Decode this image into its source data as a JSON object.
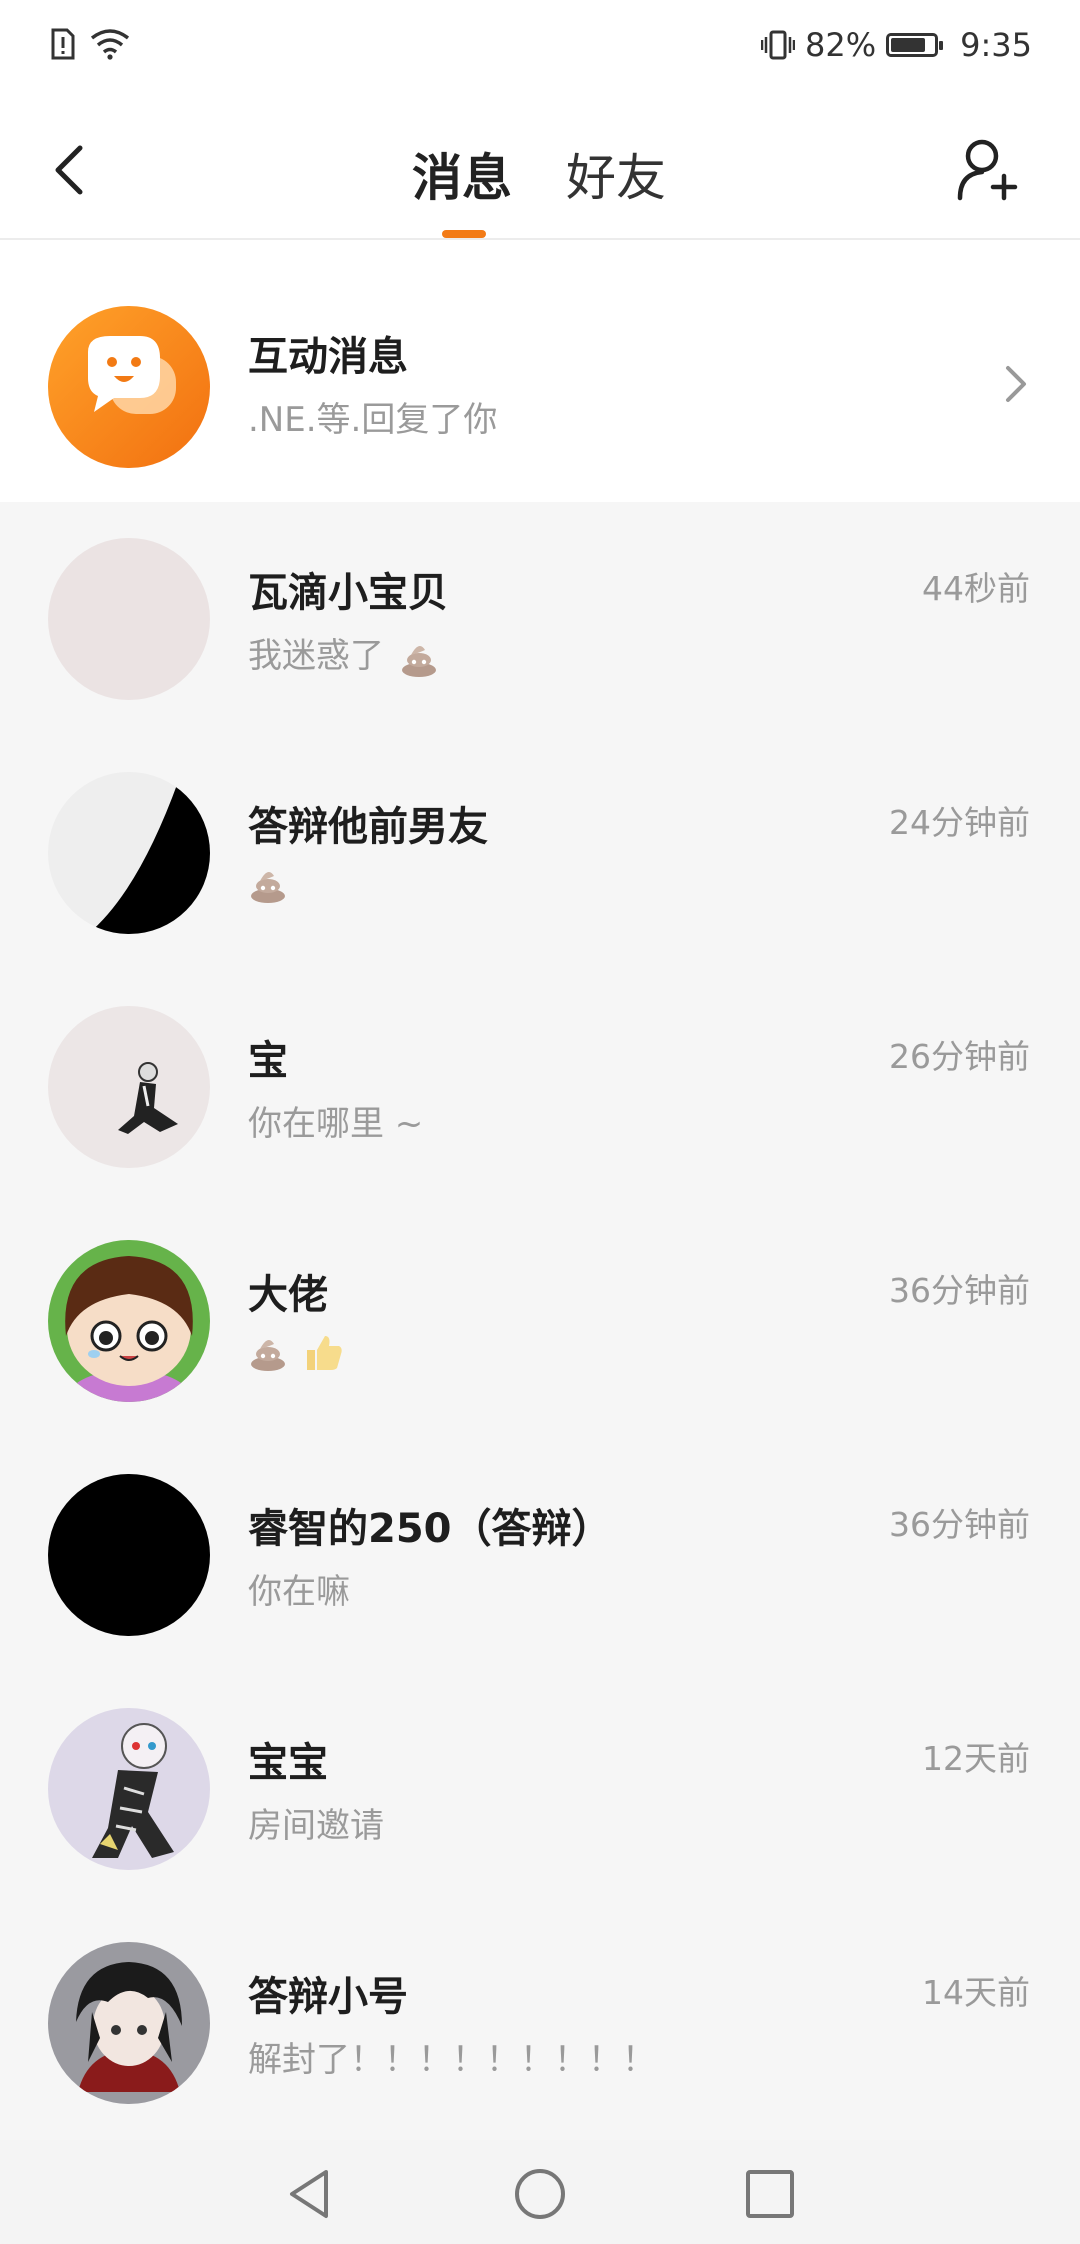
{
  "status_bar": {
    "battery_percent": "82%",
    "time": "9:35",
    "battery_level": 0.82
  },
  "header": {
    "tabs": [
      {
        "label": "消息",
        "active": true
      },
      {
        "label": "好友",
        "active": false
      }
    ],
    "accent_color": "#f37b16",
    "back_icon": "back-arrow-icon",
    "add_friend_icon": "add-person-icon"
  },
  "interactive": {
    "title": "互动消息",
    "subtitle": ".NE.等.回复了你",
    "icon": "chat-bubble-icon"
  },
  "chats": [
    {
      "name": "瓦滴小宝贝",
      "message": "我迷惑了",
      "emojis": [
        "poop"
      ],
      "time": "44秒前"
    },
    {
      "name": "答辩他前男友",
      "message": "",
      "emojis": [
        "poop"
      ],
      "time": "24分钟前"
    },
    {
      "name": "宝",
      "message": "你在哪里 ~",
      "emojis": [],
      "time": "26分钟前"
    },
    {
      "name": "大佬",
      "message": "",
      "emojis": [
        "poop",
        "thumbs-up"
      ],
      "time": "36分钟前"
    },
    {
      "name": "睿智的250（答辩）",
      "message": "你在嘛",
      "emojis": [],
      "time": "36分钟前"
    },
    {
      "name": "宝宝",
      "message": "房间邀请",
      "emojis": [],
      "time": "12天前"
    },
    {
      "name": "答辩小号",
      "message": "解封了！！！！！！！！！",
      "emojis": [],
      "time": "14天前"
    }
  ],
  "nav_bar": {
    "icons": [
      "back-triangle-icon",
      "home-circle-icon",
      "recents-square-icon"
    ]
  }
}
